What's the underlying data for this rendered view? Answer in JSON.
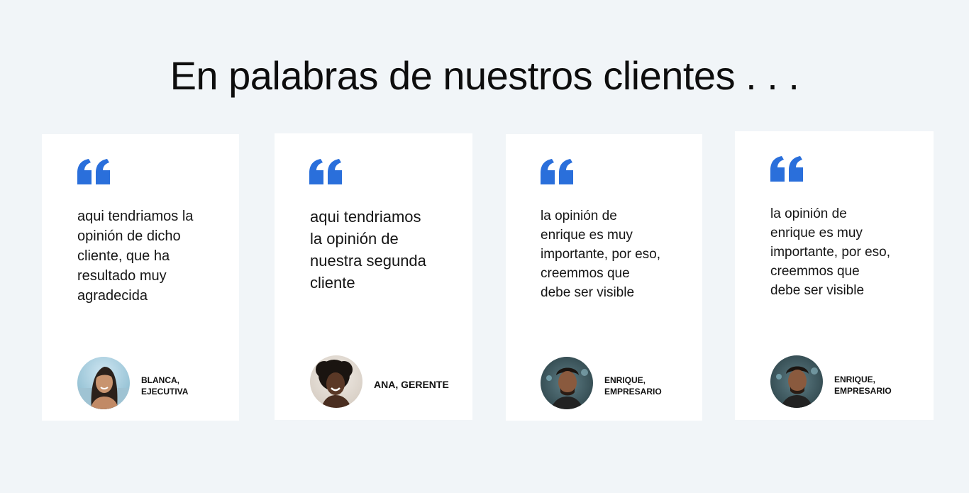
{
  "page": {
    "title": "En palabras de nuestros clientes . . .",
    "accent_color": "#2a6fdb",
    "background_color": "#f1f5f8"
  },
  "testimonials": [
    {
      "quote": "aqui tendriamos la\nopinión de dicho\ncliente, que ha\nresultado muy\nagradecida",
      "author": "BLANCA,\nEJECUTIVA",
      "avatar_icon": "woman-portrait-avatar"
    },
    {
      "quote": "aqui tendriamos\nla opinión de\nnuestra segunda\ncliente",
      "author": "ANA, GERENTE",
      "avatar_icon": "woman-portrait-avatar"
    },
    {
      "quote": "la opinión de\nenrique es muy\nimportante, por eso,\ncreemmos que\ndebe ser visible",
      "author": "ENRIQUE,\nEMPRESARIO",
      "avatar_icon": "man-portrait-avatar"
    },
    {
      "quote": "la opinión de\nenrique es muy\nimportante, por eso,\ncreemmos que\ndebe ser visible",
      "author": "ENRIQUE,\nEMPRESARIO",
      "avatar_icon": "man-portrait-avatar"
    }
  ]
}
